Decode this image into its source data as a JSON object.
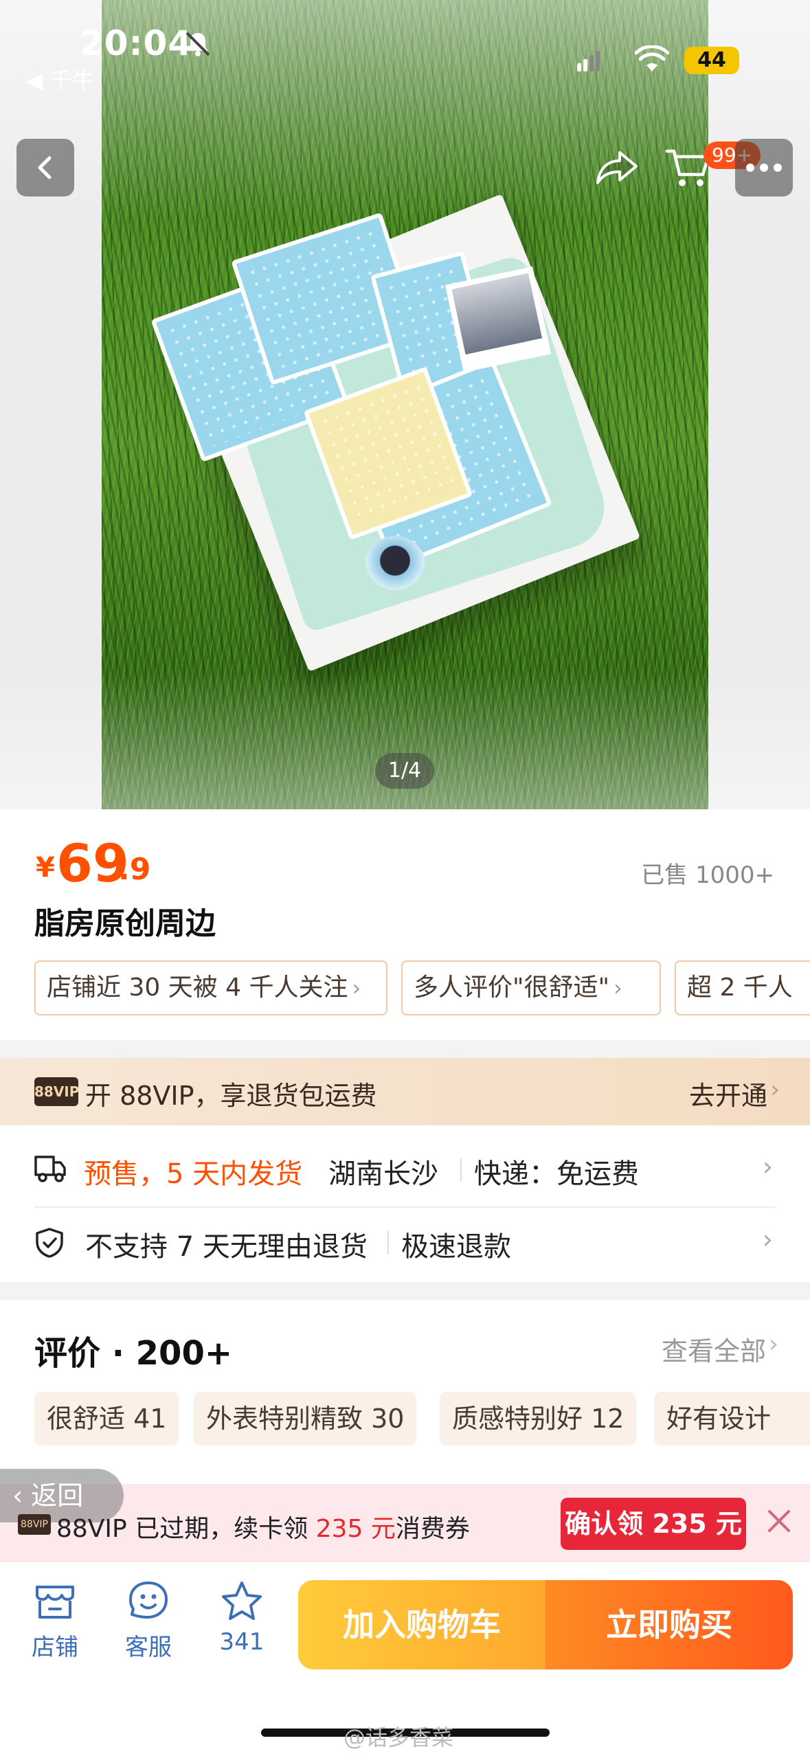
{
  "status_bar": {
    "time": "20:04",
    "back_app": "◀ 千牛",
    "battery": "44"
  },
  "nav": {
    "cart_badge": "99+"
  },
  "gallery": {
    "pager": "1/4"
  },
  "product": {
    "currency": "¥",
    "price_int": "69",
    "price_dec": ".9",
    "sold": "已售 1000+",
    "title": "脂房原创周边",
    "chips": [
      "店铺近 30 天被 4 千人关注",
      "多人评价\"很舒适\"",
      "超 2 千人"
    ]
  },
  "vip": {
    "badge": "88VIP",
    "text": "开 88VIP，享退货包运费",
    "action": "去开通"
  },
  "shipping": {
    "presale": "预售，5 天内发货",
    "location": "湖南长沙",
    "express": "快递：免运费",
    "returns": "不支持 7 天无理由退货",
    "refund": "极速退款"
  },
  "reviews": {
    "title": "评价 · 200+",
    "see_all": "查看全部",
    "tags": [
      "很舒适 41",
      "外表特别精致 30",
      "质感特别好 12",
      "好有设计"
    ]
  },
  "notice": {
    "back": "返回",
    "badge": "88VIP",
    "text_pre": "88VIP 已过期，续卡领 ",
    "amount": "235 元",
    "text_post": "消费券",
    "button": "确认领 235 元"
  },
  "bottom": {
    "store": "店铺",
    "service": "客服",
    "fav_count": "341",
    "add_cart": "加入购物车",
    "buy_now": "立即购买"
  },
  "watermark": "@话多香菜",
  "colors": {
    "accent": "#ff5000",
    "vip_dark": "#3a2a22",
    "link_blue": "#3c6fb8"
  }
}
